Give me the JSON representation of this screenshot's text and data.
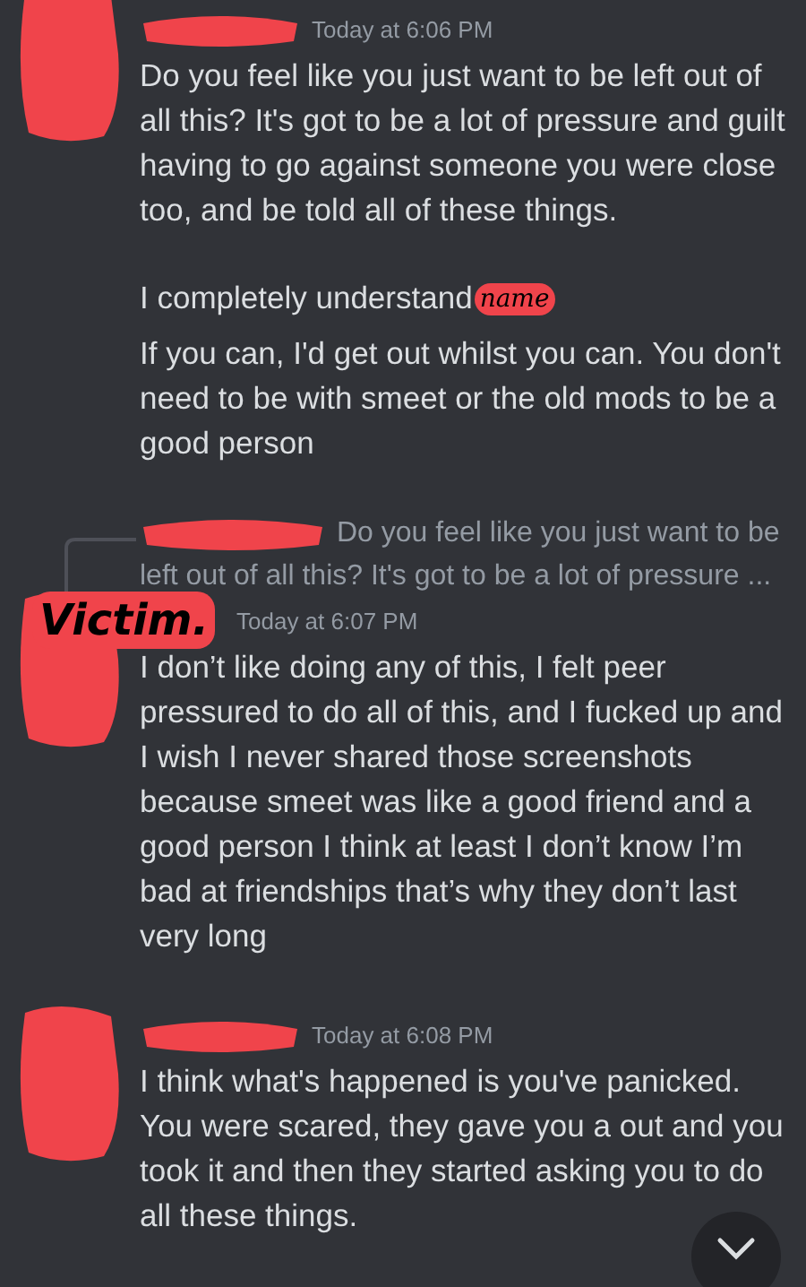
{
  "messages": [
    {
      "timestamp": "Today at 6:06 PM",
      "paragraphs": [
        {
          "text": "Do you feel like you just want to be left out of all this? It's got to be a lot of pressure and guilt having to go against someone you were close too, and be told all of these things."
        },
        {
          "text": "I completely understand",
          "annotation": "name"
        },
        {
          "text": "If you can, I'd get out whilst you can. You don't need to be with smeet or the old mods to be a good person"
        }
      ]
    },
    {
      "reply_lines": [
        "Do you feel like you just want to be",
        "left out of all this? It's got to be a lot of pressure ..."
      ],
      "avatar_annotation": "Victim.",
      "timestamp": "Today at 6:07 PM",
      "paragraphs": [
        {
          "text": "I don’t like doing any of this, I felt peer pressured to do all of this, and I fucked up and I wish I never shared those screenshots because smeet was like a good friend and a good person I think at least I don’t know I’m bad at friendships that’s why they don’t last very long"
        }
      ]
    },
    {
      "timestamp": "Today at 6:08 PM",
      "paragraphs": [
        {
          "text": "I think what's happened is you've panicked. You were scared, they gave you a out and you took it and then they started asking you to do all these things."
        }
      ]
    }
  ]
}
